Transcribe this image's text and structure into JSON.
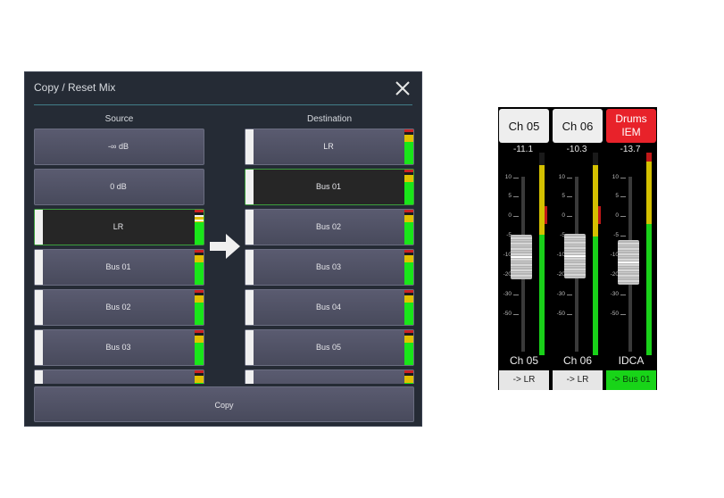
{
  "dialog": {
    "title": "Copy / Reset Mix",
    "source_header": "Source",
    "destination_header": "Destination",
    "copy_label": "Copy",
    "source_items": [
      {
        "label": "-∞ dB",
        "selected": false,
        "meter": false
      },
      {
        "label": "0 dB",
        "selected": false,
        "meter": false
      },
      {
        "label": "LR",
        "selected": true,
        "meter": true
      },
      {
        "label": "Bus 01",
        "selected": false,
        "meter": true
      },
      {
        "label": "Bus 02",
        "selected": false,
        "meter": true
      },
      {
        "label": "Bus 03",
        "selected": false,
        "meter": true
      },
      {
        "label": "",
        "selected": false,
        "meter": true
      }
    ],
    "destination_items": [
      {
        "label": "LR",
        "selected": false,
        "meter": true
      },
      {
        "label": "Bus 01",
        "selected": true,
        "meter": true
      },
      {
        "label": "Bus 02",
        "selected": false,
        "meter": true
      },
      {
        "label": "Bus 03",
        "selected": false,
        "meter": true
      },
      {
        "label": "Bus 04",
        "selected": false,
        "meter": true
      },
      {
        "label": "Bus 05",
        "selected": false,
        "meter": true
      },
      {
        "label": "",
        "selected": false,
        "meter": true
      }
    ]
  },
  "mixer": {
    "scale": [
      "10",
      "5",
      "0",
      "-5",
      "-10",
      "-20",
      "-30",
      "-50"
    ],
    "strips": [
      {
        "name": "Ch 05",
        "gain": "-11.1",
        "label": "Ch 05",
        "route": "-> LR",
        "route_active": false,
        "name_color": "#eeeeee"
      },
      {
        "name": "Ch 06",
        "gain": "-10.3",
        "label": "Ch 06",
        "route": "-> LR",
        "route_active": false,
        "name_color": "#eeeeee"
      },
      {
        "name": "Drums IEM",
        "gain": "-13.7",
        "label": "IDCA",
        "route": "-> Bus 01",
        "route_active": true,
        "name_color": "#e8222a"
      }
    ]
  }
}
